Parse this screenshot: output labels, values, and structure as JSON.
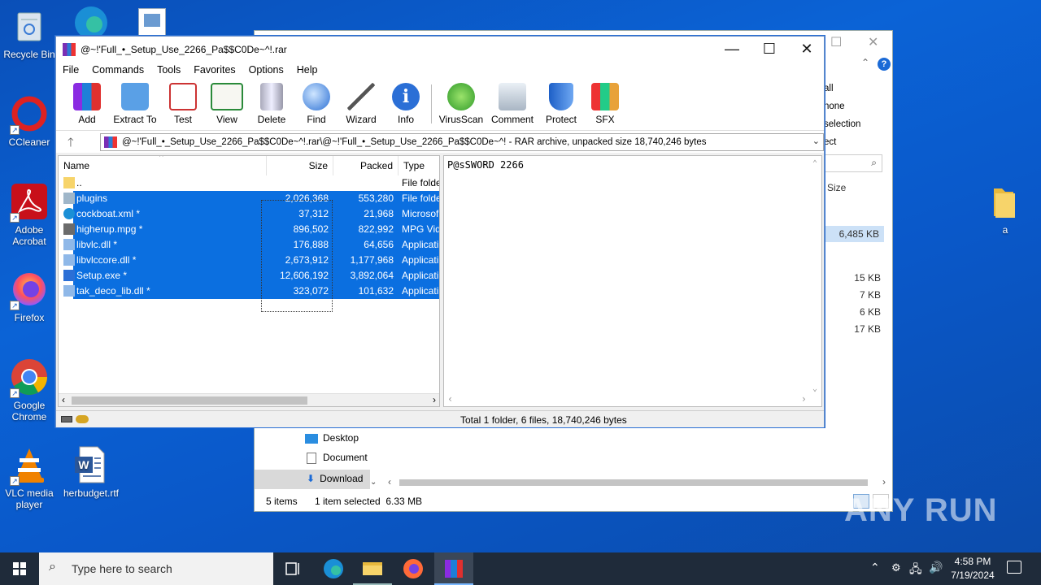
{
  "desktop": {
    "icons": [
      {
        "label": "Recycle Bin"
      },
      {
        "label": "CCleaner"
      },
      {
        "label": "Adobe Acrobat"
      },
      {
        "label": "Firefox"
      },
      {
        "label": "Google Chrome"
      },
      {
        "label": "VLC media player"
      },
      {
        "label": "herbudget.rtf"
      },
      {
        "label": "a"
      }
    ]
  },
  "explorer": {
    "ribbon_items": [
      "all",
      "none",
      "selection",
      "ect"
    ],
    "column_size": "Size",
    "sizes": [
      "6,485 KB",
      "15 KB",
      "7 KB",
      "6 KB",
      "17 KB"
    ],
    "nav": [
      {
        "label": "Desktop"
      },
      {
        "label": "Document"
      },
      {
        "label": "Download"
      }
    ],
    "status_items": "5 items",
    "status_selected": "1 item selected  6.33 MB"
  },
  "winrar": {
    "title": "@~!'Full_•_Setup_Use_2266_Pa$$C0De~^!.rar",
    "menu": [
      "File",
      "Commands",
      "Tools",
      "Favorites",
      "Options",
      "Help"
    ],
    "toolbar": [
      {
        "label": "Add",
        "icon": "add-icon"
      },
      {
        "label": "Extract To",
        "icon": "extract-icon"
      },
      {
        "label": "Test",
        "icon": "test-icon"
      },
      {
        "label": "View",
        "icon": "view-icon"
      },
      {
        "label": "Delete",
        "icon": "delete-icon"
      },
      {
        "label": "Find",
        "icon": "find-icon"
      },
      {
        "label": "Wizard",
        "icon": "wizard-icon"
      },
      {
        "label": "Info",
        "icon": "info-icon"
      },
      {
        "label": "VirusScan",
        "icon": "virusscan-icon"
      },
      {
        "label": "Comment",
        "icon": "comment-icon"
      },
      {
        "label": "Protect",
        "icon": "protect-icon"
      },
      {
        "label": "SFX",
        "icon": "sfx-icon"
      }
    ],
    "address": "@~!'Full_•_Setup_Use_2266_Pa$$C0De~^!.rar\\@~!'Full_•_Setup_Use_2266_Pa$$C0De~^! - RAR archive, unpacked size 18,740,246 bytes",
    "columns": {
      "name": "Name",
      "size": "Size",
      "packed": "Packed",
      "type": "Type"
    },
    "files": [
      {
        "name": "..",
        "size": "",
        "packed": "",
        "type": "File folde",
        "selected": false,
        "icon": "folder-up-icon"
      },
      {
        "name": "plugins",
        "size": "2,026,368",
        "packed": "553,280",
        "type": "File folde",
        "selected": true,
        "icon": "folder-icon"
      },
      {
        "name": "cockboat.xml *",
        "size": "37,312",
        "packed": "21,968",
        "type": "Microsof",
        "selected": true,
        "icon": "edge-icon"
      },
      {
        "name": "higherup.mpg *",
        "size": "896,502",
        "packed": "822,992",
        "type": "MPG Vid",
        "selected": true,
        "icon": "video-icon"
      },
      {
        "name": "libvlc.dll *",
        "size": "176,888",
        "packed": "64,656",
        "type": "Applicati",
        "selected": true,
        "icon": "dll-icon"
      },
      {
        "name": "libvlccore.dll *",
        "size": "2,673,912",
        "packed": "1,177,968",
        "type": "Applicati",
        "selected": true,
        "icon": "dll-icon"
      },
      {
        "name": "Setup.exe *",
        "size": "12,606,192",
        "packed": "3,892,064",
        "type": "Applicati",
        "selected": true,
        "icon": "exe-icon"
      },
      {
        "name": "tak_deco_lib.dll *",
        "size": "323,072",
        "packed": "101,632",
        "type": "Applicati",
        "selected": true,
        "icon": "dll-icon"
      }
    ],
    "comment": "P@sSWORD 2266",
    "status": "Total 1 folder, 6 files, 18,740,246 bytes"
  },
  "taskbar": {
    "search_placeholder": "Type here to search",
    "time": "4:58 PM",
    "date": "7/19/2024"
  },
  "watermark": "ANY RUN"
}
